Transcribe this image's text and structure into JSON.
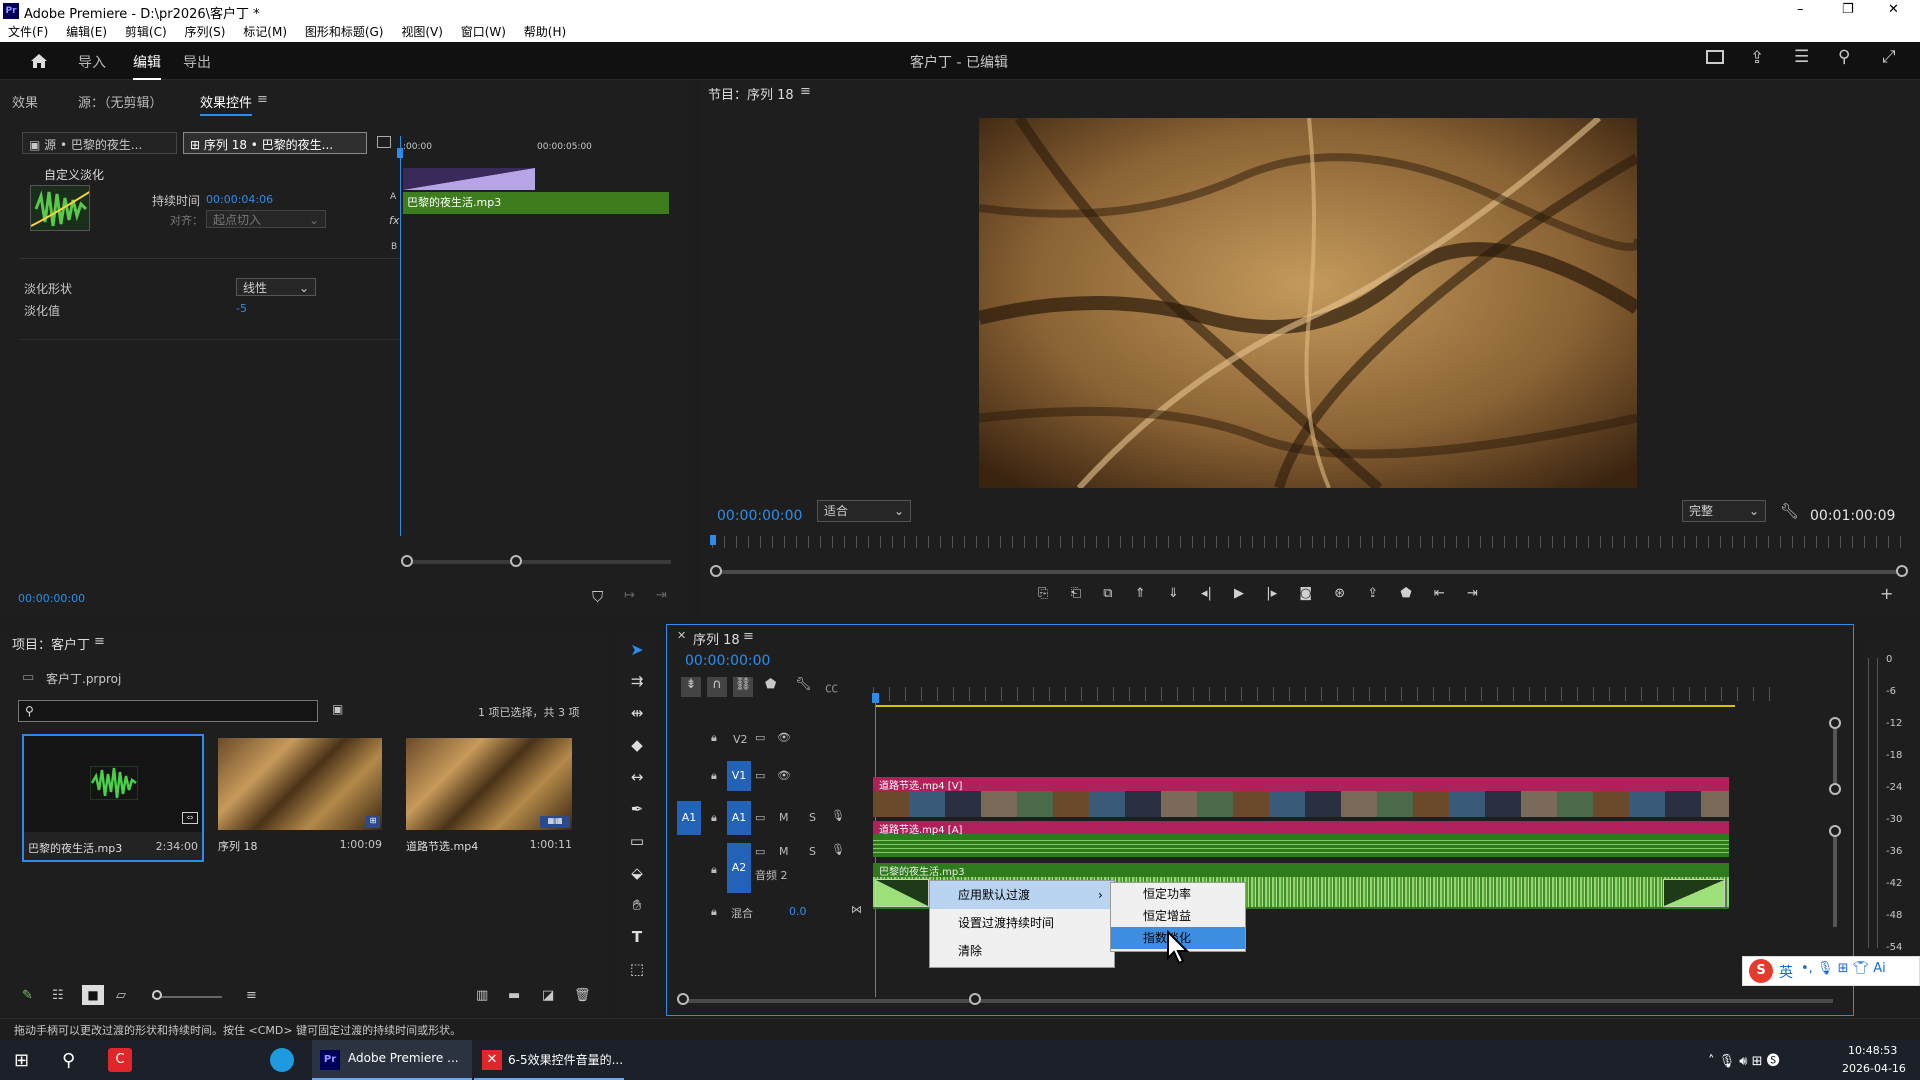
{
  "window": {
    "app_icon": "Pr",
    "title": "Adobe Premiere - D:\\pr2026\\客户丁 *",
    "min": "–",
    "max": "❐",
    "close": "✕"
  },
  "menu": [
    "文件(F)",
    "编辑(E)",
    "剪辑(C)",
    "序列(S)",
    "标记(M)",
    "图形和标题(G)",
    "视图(V)",
    "窗口(W)",
    "帮助(H)"
  ],
  "appbar": {
    "tabs": [
      "导入",
      "编辑",
      "导出"
    ],
    "center_title": "客户丁 - 已编辑"
  },
  "effect_panel": {
    "tabs": [
      "效果",
      "源：（无剪辑）",
      "效果控件"
    ],
    "source_label": "源 • 巴黎的夜生...",
    "sequence_label": "序列 18 • 巴黎的夜生...",
    "effect_name": "自定义淡化",
    "duration_label": "持续时间",
    "duration_value": "00:00:04:06",
    "align_label": "对齐：",
    "align_value": "起点切入",
    "ruler_start": ":00:00",
    "ruler_mid": "00:00:05:00",
    "track_a": "A",
    "track_b": "B",
    "fx": "fx",
    "clip_name": "巴黎的夜生活.mp3",
    "fade_shape_label": "淡化形状",
    "fade_shape_value": "线性",
    "fade_value_label": "淡化值",
    "fade_value": "-5",
    "timecode": "00:00:00:00"
  },
  "program": {
    "title": "节目：序列 18",
    "timecode_left": "00:00:00:00",
    "fit": "适合",
    "quality": "完整",
    "timecode_right": "00:01:00:09"
  },
  "project": {
    "title": "项目：客户丁",
    "file": "客户丁.prproj",
    "search_placeholder": "",
    "selection": "1 项已选择，共 3 项",
    "items": [
      {
        "name": "巴黎的夜生活.mp3",
        "duration": "2:34:00"
      },
      {
        "name": "序列 18",
        "duration": "1:00:09"
      },
      {
        "name": "道路节选.mp4",
        "duration": "1:00:11"
      }
    ]
  },
  "timeline": {
    "title": "序列 18",
    "timecode": "00:00:00:00",
    "tracks": {
      "v2": "V2",
      "v1": "V1",
      "a1": "A1",
      "a2": "A2",
      "a2_name": "音频 2",
      "mix": "混合",
      "mix_value": "0.0",
      "m": "M",
      "s": "S"
    },
    "clips": {
      "video": "道路节选.mp4 [V]",
      "audio1": "道路节选.mp4 [A]",
      "audio2": "巴黎的夜生活.mp3"
    }
  },
  "context_menu": {
    "items": [
      "应用默认过渡",
      "设置过渡持续时间",
      "清除"
    ],
    "submenu": [
      "恒定功率",
      "恒定增益",
      "指数淡化"
    ]
  },
  "meter_labels": [
    "0",
    "-6",
    "-12",
    "-18",
    "-24",
    "-30",
    "-36",
    "-42",
    "-48",
    "-54"
  ],
  "status_bar": "拖动手柄可以更改过渡的形状和持续时间。按住 <CMD> 键可固定过渡的持续时间或形状。",
  "ime": {
    "logo": "S",
    "text": "英"
  },
  "taskbar": {
    "apps": [
      "Adobe Premiere ...",
      "6-5效果控件音量的..."
    ],
    "time": "10:48:53",
    "date": "2026-04-16"
  },
  "colors": {
    "accent": "#2d8ceb",
    "video_clip": "#b0205a",
    "audio_clip": "#2f7a1c",
    "playhead": "#2d8ceb",
    "work_area": "#d6c21a"
  }
}
